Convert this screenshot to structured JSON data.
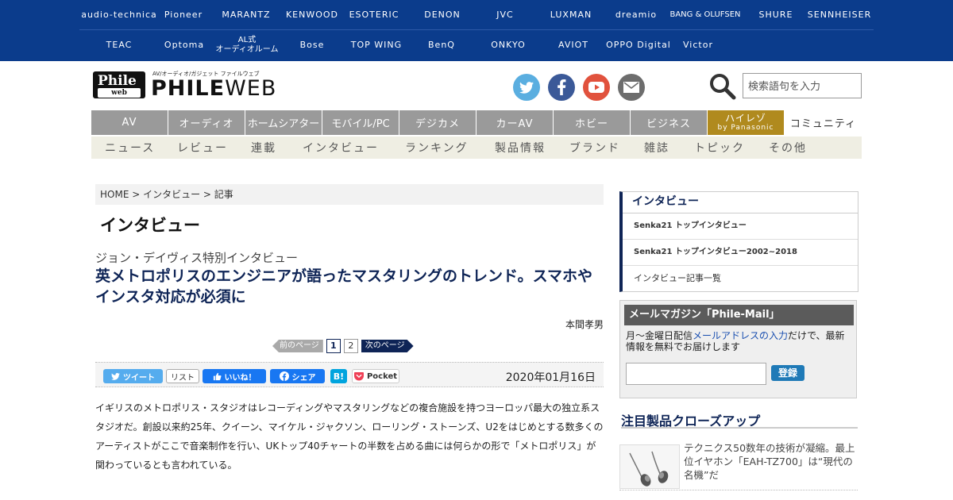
{
  "brands": {
    "row1": [
      "audio-technica",
      "Pioneer",
      "MARANTZ",
      "KENWOOD",
      "ESOTERIC",
      "DENON",
      "JVC",
      "LUXMAN",
      "dreamio",
      "BANG & OLUFSEN",
      "SHURE",
      "SENNHEISER"
    ],
    "row2": [
      "TEAC",
      "Optoma",
      "AL式\nオーディオルーム",
      "Bose",
      "TOP WING",
      "BenQ",
      "ONKYO",
      "AVIOT",
      "OPPO Digital",
      "Victor"
    ]
  },
  "logo": {
    "badge_top": "Phile",
    "badge_bottom": "web",
    "tagline": "AV/オーディオ/ガジェット ファイルウェブ",
    "word_bold": "PHILE",
    "word_light": "WEB"
  },
  "social": [
    {
      "name": "twitter-icon",
      "color": "#5aaee0"
    },
    {
      "name": "facebook-icon",
      "color": "#3b5998"
    },
    {
      "name": "youtube-icon",
      "color": "#e1523d"
    },
    {
      "name": "mail-icon",
      "color": "#6d6d6d"
    }
  ],
  "search": {
    "placeholder": "検索語句を入力"
  },
  "main_nav": [
    "AV",
    "オーディオ",
    "ホームシアター",
    "モバイル/PC",
    "デジカメ",
    "カーAV",
    "ホビー",
    "ビジネス"
  ],
  "hires_nav": {
    "line1": "ハイレゾ",
    "line2": "by Panasonic",
    "color": "#b08a1e"
  },
  "community_nav": "コミュニティ",
  "sub_nav": [
    "ニュース",
    "レビュー",
    "連載",
    "インタビュー",
    "ランキング",
    "製品情報",
    "ブランド",
    "雑誌",
    "トピック",
    "その他"
  ],
  "article": {
    "breadcrumb": "HOME > インタビュー > 記事",
    "section_title": "インタビュー",
    "subtitle": "ジョン・デイヴィス特別インタビュー",
    "headline": "英メトロポリスのエンジニアが語ったマスタリングのトレンド。スマホやインスタ対応が必須に",
    "author": "本間孝男",
    "pager": {
      "prev": "前のページ",
      "pages": [
        "1",
        "2"
      ],
      "current": "1",
      "next": "次のページ"
    },
    "share": {
      "tweet": "ツイート",
      "list": "リスト",
      "like": "いいね！",
      "share": "シェア",
      "hatena": "B!",
      "pocket": "Pocket"
    },
    "date": "2020年01月16日",
    "body": "イギリスのメトロポリス・スタジオはレコーディングやマスタリングなどの複合施設を持つヨーロッパ最大の独立系スタジオだ。創設以来約25年、クイーン、マイケル・ジャクソン、ローリング・ストーンズ、U2をはじめとする数多くのアーティストがここで音楽制作を行い、UKトップ40チャートの半数を占める曲には何らかの形で「メトロポリス」が関わっているとも言われている。"
  },
  "sidebar": {
    "interview": {
      "title": "インタビュー",
      "items": [
        "Senka21 トップインタビュー",
        "Senka21 トップインタビュー2002~2018",
        "インタビュー記事一覧"
      ]
    },
    "mail": {
      "title": "メールマガジン「Phile-Mail」",
      "desc_pre": "月～金曜日配信",
      "desc_link": "メールアドレスの入力",
      "desc_post": "だけで、最新情報を無料でお届けします",
      "button": "登録"
    },
    "featured": {
      "title": "注目製品クローズアップ",
      "items": [
        "テクニクス50数年の技術が凝縮。最上位イヤホン「EAH-TZ700」は“現代の名機”だ"
      ]
    }
  },
  "colors": {
    "brand_bar": "#0b3c8c",
    "nav_gray": "#9a9a9a",
    "accent_navy": "#0e2456"
  }
}
